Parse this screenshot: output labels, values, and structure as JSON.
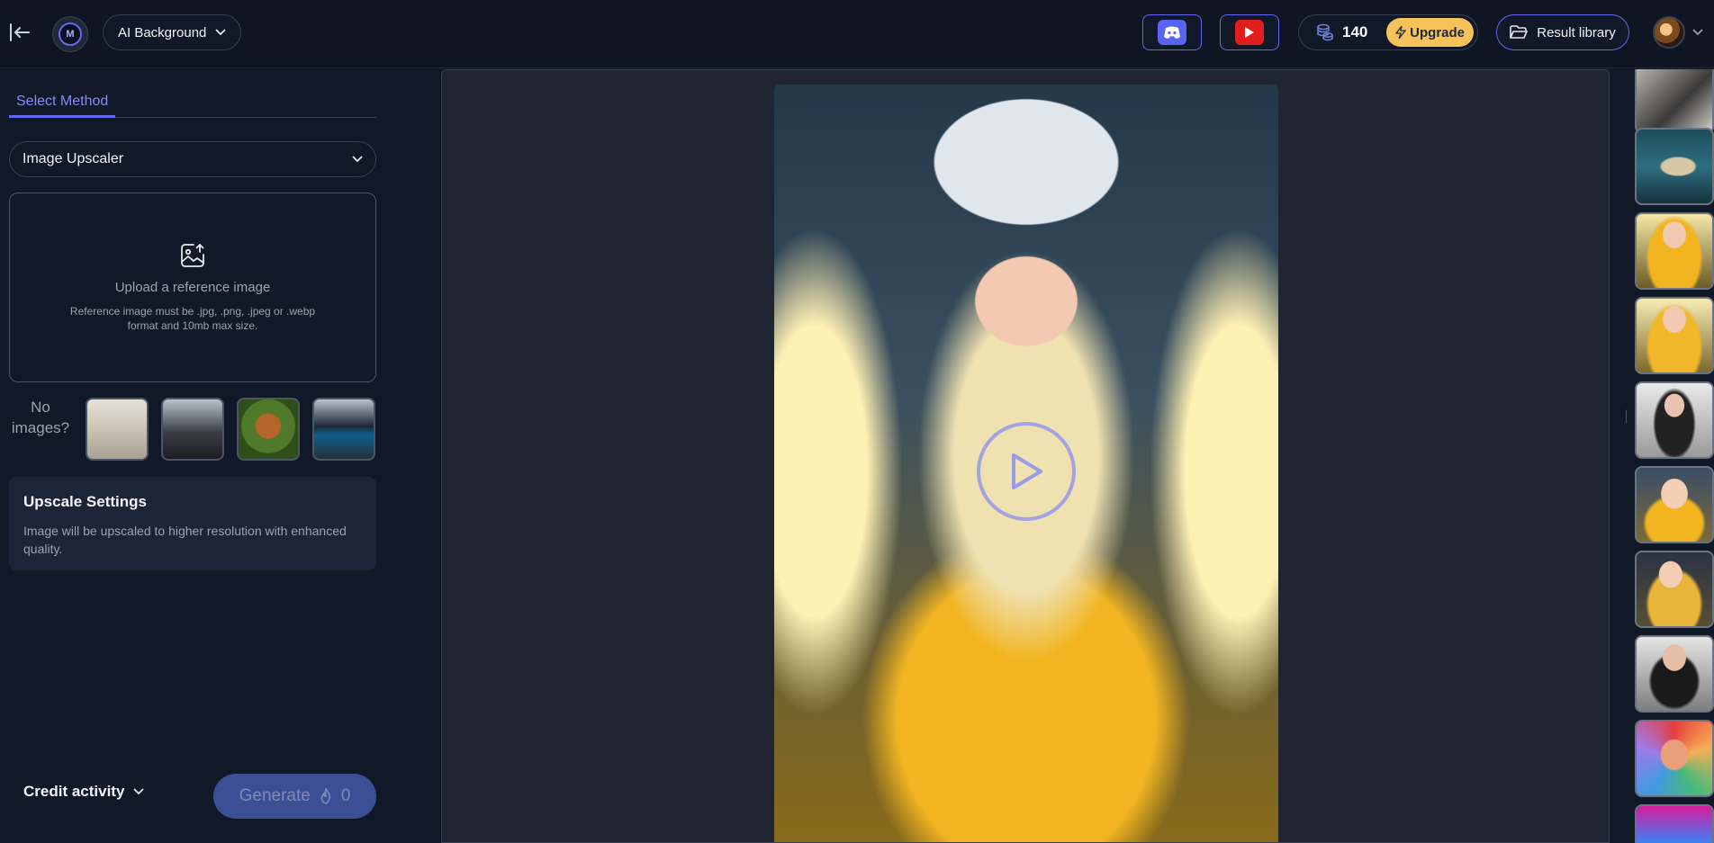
{
  "topbar": {
    "mode_label": "AI Background",
    "credits": "140",
    "upgrade_label": "Upgrade",
    "result_library_label": "Result library"
  },
  "left": {
    "tab_label": "Select Method",
    "method_value": "Image Upscaler",
    "upload_title": "Upload a reference image",
    "upload_hint": "Reference image must be .jpg, .png, .jpeg or .webp format and 10mb max size.",
    "no_images_label": "No images?",
    "settings_title": "Upscale Settings",
    "settings_desc": "Image will be upscaled to higher resolution with enhanced quality.",
    "credit_activity_label": "Credit activity",
    "generate_label": "Generate",
    "generate_cost": "0"
  },
  "colors": {
    "accent": "#6366f1",
    "upgrade": "#f6c35a",
    "background": "#111827",
    "generate": "#3b4f95"
  },
  "icons": [
    "collapse-icon",
    "logo-icon",
    "chevron-down-icon",
    "discord-icon",
    "youtube-icon",
    "coins-icon",
    "bolt-icon",
    "folder-icon",
    "image-upload-icon",
    "flame-icon",
    "play-icon"
  ]
}
